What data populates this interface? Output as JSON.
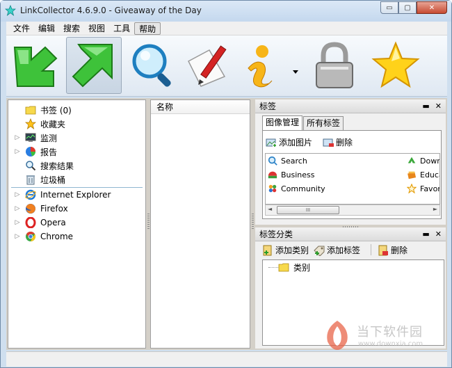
{
  "window": {
    "title": "LinkCollector 4.6.9.0 - Giveaway of the Day"
  },
  "window_controls": {
    "minimize": "▭",
    "maximize": "▢",
    "close": "✕"
  },
  "menu": [
    "文件",
    "编辑",
    "搜索",
    "视图",
    "工具",
    "帮助"
  ],
  "toolbar": [
    {
      "icon": "green-down-arrow-icon"
    },
    {
      "icon": "green-up-arrow-icon"
    },
    {
      "icon": "magnifier-icon"
    },
    {
      "icon": "paper-pencil-icon"
    },
    {
      "icon": "info-icon"
    },
    {
      "icon": "padlock-icon"
    },
    {
      "icon": "star-icon"
    }
  ],
  "tree": {
    "top": [
      {
        "label": "书签 (0)",
        "icon": "folder-icon"
      },
      {
        "label": "收藏夹",
        "icon": "star-icon"
      },
      {
        "label": "监测",
        "icon": "monitor-icon"
      },
      {
        "label": "报告",
        "icon": "pie-chart-icon"
      },
      {
        "label": "搜索结果",
        "icon": "magnifier-icon"
      },
      {
        "label": "垃圾桶",
        "icon": "trash-icon"
      }
    ],
    "browsers": [
      {
        "label": "Internet Explorer",
        "icon": "ie-icon"
      },
      {
        "label": "Firefox",
        "icon": "firefox-icon"
      },
      {
        "label": "Opera",
        "icon": "opera-icon"
      },
      {
        "label": "Chrome",
        "icon": "chrome-icon"
      }
    ]
  },
  "list": {
    "column_name": "名称"
  },
  "tags_panel": {
    "title": "标签",
    "pin": "▬",
    "close": "✕",
    "tabs": [
      "图像管理",
      "所有标签"
    ],
    "add_image": "添加图片",
    "delete": "删除",
    "left_tags": [
      "Search",
      "Business",
      "Community"
    ],
    "right_tags": [
      "Down",
      "Educa",
      "Favor"
    ],
    "scroll_left": "◄",
    "scroll_right": "►",
    "scroll_grip": "III"
  },
  "categories_panel": {
    "title": "标签分类",
    "pin": "▬",
    "close": "✕",
    "add_category": "添加类别",
    "add_tag": "添加标签",
    "delete": "删除",
    "root": "类别"
  },
  "watermark": {
    "name": "当下软件园",
    "url": "www.downxia.com"
  }
}
